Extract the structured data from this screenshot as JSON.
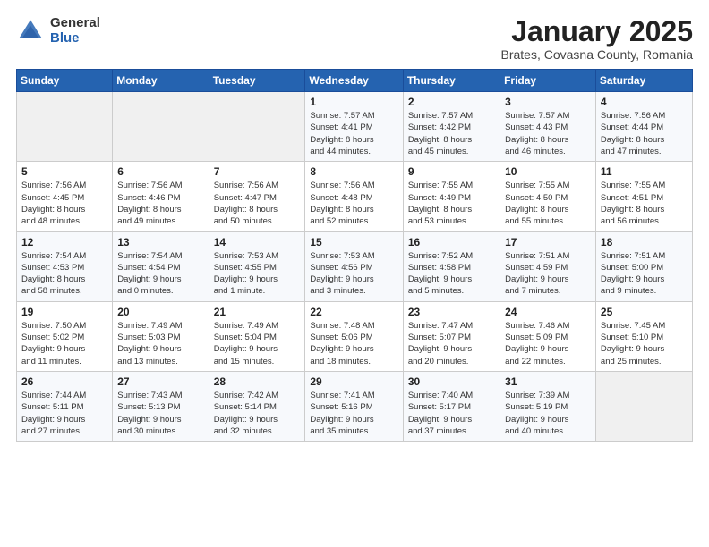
{
  "logo": {
    "general": "General",
    "blue": "Blue"
  },
  "title": "January 2025",
  "subtitle": "Brates, Covasna County, Romania",
  "days_header": [
    "Sunday",
    "Monday",
    "Tuesday",
    "Wednesday",
    "Thursday",
    "Friday",
    "Saturday"
  ],
  "weeks": [
    [
      {
        "day": "",
        "info": ""
      },
      {
        "day": "",
        "info": ""
      },
      {
        "day": "",
        "info": ""
      },
      {
        "day": "1",
        "info": "Sunrise: 7:57 AM\nSunset: 4:41 PM\nDaylight: 8 hours\nand 44 minutes."
      },
      {
        "day": "2",
        "info": "Sunrise: 7:57 AM\nSunset: 4:42 PM\nDaylight: 8 hours\nand 45 minutes."
      },
      {
        "day": "3",
        "info": "Sunrise: 7:57 AM\nSunset: 4:43 PM\nDaylight: 8 hours\nand 46 minutes."
      },
      {
        "day": "4",
        "info": "Sunrise: 7:56 AM\nSunset: 4:44 PM\nDaylight: 8 hours\nand 47 minutes."
      }
    ],
    [
      {
        "day": "5",
        "info": "Sunrise: 7:56 AM\nSunset: 4:45 PM\nDaylight: 8 hours\nand 48 minutes."
      },
      {
        "day": "6",
        "info": "Sunrise: 7:56 AM\nSunset: 4:46 PM\nDaylight: 8 hours\nand 49 minutes."
      },
      {
        "day": "7",
        "info": "Sunrise: 7:56 AM\nSunset: 4:47 PM\nDaylight: 8 hours\nand 50 minutes."
      },
      {
        "day": "8",
        "info": "Sunrise: 7:56 AM\nSunset: 4:48 PM\nDaylight: 8 hours\nand 52 minutes."
      },
      {
        "day": "9",
        "info": "Sunrise: 7:55 AM\nSunset: 4:49 PM\nDaylight: 8 hours\nand 53 minutes."
      },
      {
        "day": "10",
        "info": "Sunrise: 7:55 AM\nSunset: 4:50 PM\nDaylight: 8 hours\nand 55 minutes."
      },
      {
        "day": "11",
        "info": "Sunrise: 7:55 AM\nSunset: 4:51 PM\nDaylight: 8 hours\nand 56 minutes."
      }
    ],
    [
      {
        "day": "12",
        "info": "Sunrise: 7:54 AM\nSunset: 4:53 PM\nDaylight: 8 hours\nand 58 minutes."
      },
      {
        "day": "13",
        "info": "Sunrise: 7:54 AM\nSunset: 4:54 PM\nDaylight: 9 hours\nand 0 minutes."
      },
      {
        "day": "14",
        "info": "Sunrise: 7:53 AM\nSunset: 4:55 PM\nDaylight: 9 hours\nand 1 minute."
      },
      {
        "day": "15",
        "info": "Sunrise: 7:53 AM\nSunset: 4:56 PM\nDaylight: 9 hours\nand 3 minutes."
      },
      {
        "day": "16",
        "info": "Sunrise: 7:52 AM\nSunset: 4:58 PM\nDaylight: 9 hours\nand 5 minutes."
      },
      {
        "day": "17",
        "info": "Sunrise: 7:51 AM\nSunset: 4:59 PM\nDaylight: 9 hours\nand 7 minutes."
      },
      {
        "day": "18",
        "info": "Sunrise: 7:51 AM\nSunset: 5:00 PM\nDaylight: 9 hours\nand 9 minutes."
      }
    ],
    [
      {
        "day": "19",
        "info": "Sunrise: 7:50 AM\nSunset: 5:02 PM\nDaylight: 9 hours\nand 11 minutes."
      },
      {
        "day": "20",
        "info": "Sunrise: 7:49 AM\nSunset: 5:03 PM\nDaylight: 9 hours\nand 13 minutes."
      },
      {
        "day": "21",
        "info": "Sunrise: 7:49 AM\nSunset: 5:04 PM\nDaylight: 9 hours\nand 15 minutes."
      },
      {
        "day": "22",
        "info": "Sunrise: 7:48 AM\nSunset: 5:06 PM\nDaylight: 9 hours\nand 18 minutes."
      },
      {
        "day": "23",
        "info": "Sunrise: 7:47 AM\nSunset: 5:07 PM\nDaylight: 9 hours\nand 20 minutes."
      },
      {
        "day": "24",
        "info": "Sunrise: 7:46 AM\nSunset: 5:09 PM\nDaylight: 9 hours\nand 22 minutes."
      },
      {
        "day": "25",
        "info": "Sunrise: 7:45 AM\nSunset: 5:10 PM\nDaylight: 9 hours\nand 25 minutes."
      }
    ],
    [
      {
        "day": "26",
        "info": "Sunrise: 7:44 AM\nSunset: 5:11 PM\nDaylight: 9 hours\nand 27 minutes."
      },
      {
        "day": "27",
        "info": "Sunrise: 7:43 AM\nSunset: 5:13 PM\nDaylight: 9 hours\nand 30 minutes."
      },
      {
        "day": "28",
        "info": "Sunrise: 7:42 AM\nSunset: 5:14 PM\nDaylight: 9 hours\nand 32 minutes."
      },
      {
        "day": "29",
        "info": "Sunrise: 7:41 AM\nSunset: 5:16 PM\nDaylight: 9 hours\nand 35 minutes."
      },
      {
        "day": "30",
        "info": "Sunrise: 7:40 AM\nSunset: 5:17 PM\nDaylight: 9 hours\nand 37 minutes."
      },
      {
        "day": "31",
        "info": "Sunrise: 7:39 AM\nSunset: 5:19 PM\nDaylight: 9 hours\nand 40 minutes."
      },
      {
        "day": "",
        "info": ""
      }
    ]
  ]
}
